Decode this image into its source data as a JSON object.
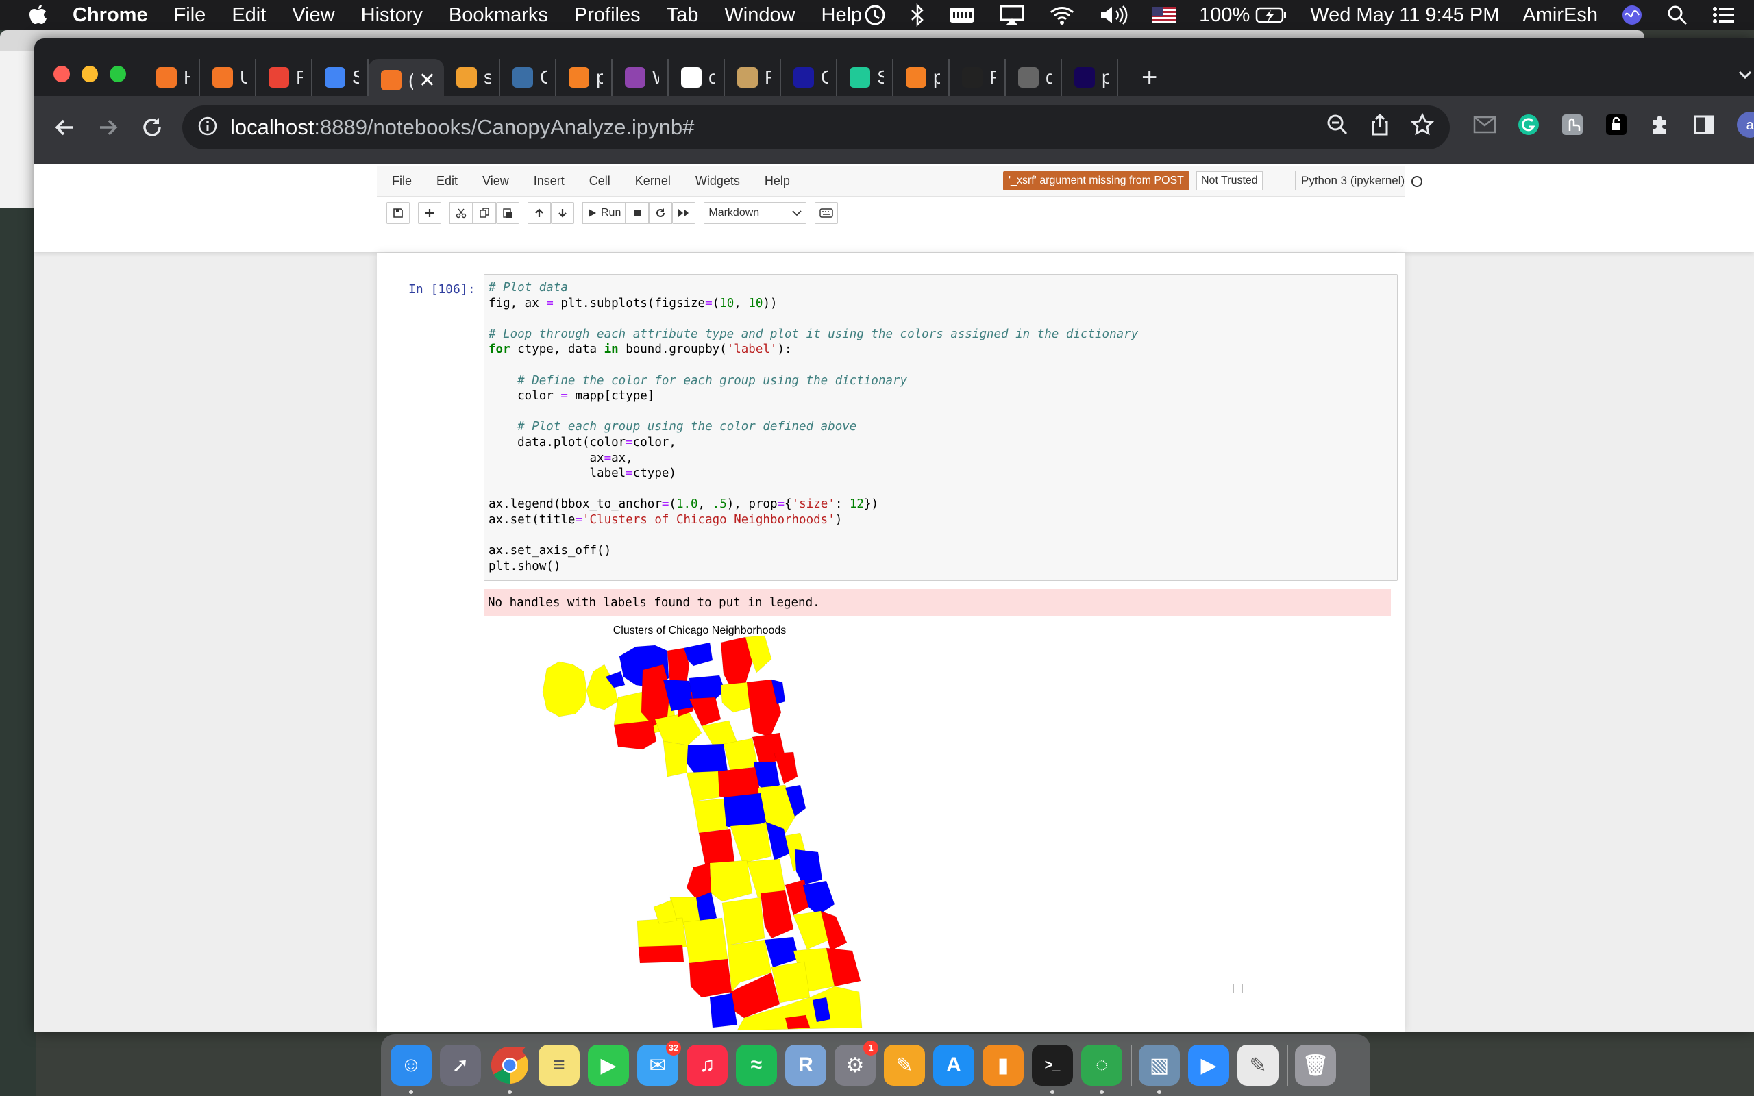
{
  "menubar": {
    "items": [
      "Chrome",
      "File",
      "Edit",
      "View",
      "History",
      "Bookmarks",
      "Profiles",
      "Tab",
      "Window",
      "Help"
    ],
    "battery": "100%",
    "datetime": "Wed May 11  9:45 PM",
    "user": "AmirEsh"
  },
  "tabs": [
    {
      "label": "Hom",
      "color": "#f37626"
    },
    {
      "label": "Unti",
      "color": "#f37626"
    },
    {
      "label": "Fwd",
      "color": "#ea4335"
    },
    {
      "label": "SoR",
      "color": "#4285f4"
    },
    {
      "label": "(",
      "color": "#f37626"
    },
    {
      "label": "skle",
      "color": "#f0a030"
    },
    {
      "label": "Cus",
      "color": "#3a6ea5"
    },
    {
      "label": "pyth",
      "color": "#f48024"
    },
    {
      "label": "War",
      "color": "#8e44ad"
    },
    {
      "label": "chic",
      "color": "#ffffff"
    },
    {
      "label": "Plot",
      "color": "#c8a060"
    },
    {
      "label": "Ope",
      "color": "#1a1aa0"
    },
    {
      "label": "Sha",
      "color": "#20c997"
    },
    {
      "label": "pyth",
      "color": "#f48024"
    },
    {
      "label": "Plot",
      "color": "#222222"
    },
    {
      "label": "data",
      "color": "#666666"
    },
    {
      "label": "pan",
      "color": "#150458"
    }
  ],
  "address": {
    "host": "localhost",
    "rest": ":8889/notebooks/CanopyAnalyze.ipynb#"
  },
  "profile_initial": "a",
  "notebook": {
    "menu": [
      "File",
      "Edit",
      "View",
      "Insert",
      "Cell",
      "Kernel",
      "Widgets",
      "Help"
    ],
    "xsrf_warning": "'_xsrf' argument missing from POST",
    "trust": "Not Trusted",
    "kernel": "Python 3 (ipykernel)",
    "run_label": "Run",
    "cell_type": "Markdown",
    "prompt": "In [106]:",
    "code_lines": [
      [
        [
          "cm",
          "# Plot data"
        ]
      ],
      [
        [
          "",
          "fig, ax "
        ],
        [
          "op",
          "="
        ],
        [
          "",
          " plt.subplots(figsize"
        ],
        [
          "op",
          "="
        ],
        [
          "",
          "("
        ],
        [
          "nu",
          "10"
        ],
        [
          "",
          ", "
        ],
        [
          "nu",
          "10"
        ],
        [
          "",
          "))"
        ]
      ],
      [
        [
          "",
          ""
        ]
      ],
      [
        [
          "cm",
          "# Loop through each attribute type and plot it using the colors assigned in the dictionary"
        ]
      ],
      [
        [
          "kw",
          "for"
        ],
        [
          "",
          " ctype, data "
        ],
        [
          "kw",
          "in"
        ],
        [
          "",
          " bound.groupby("
        ],
        [
          "st",
          "'label'"
        ],
        [
          "",
          "):"
        ]
      ],
      [
        [
          "",
          ""
        ]
      ],
      [
        [
          "",
          "    "
        ],
        [
          "cm",
          "# Define the color for each group using the dictionary"
        ]
      ],
      [
        [
          "",
          "    color "
        ],
        [
          "op",
          "="
        ],
        [
          "",
          " mapp[ctype]"
        ]
      ],
      [
        [
          "",
          ""
        ]
      ],
      [
        [
          "",
          "    "
        ],
        [
          "cm",
          "# Plot each group using the color defined above"
        ]
      ],
      [
        [
          "",
          "    data.plot(color"
        ],
        [
          "op",
          "="
        ],
        [
          "",
          "color,"
        ]
      ],
      [
        [
          "",
          "              ax"
        ],
        [
          "op",
          "="
        ],
        [
          "",
          "ax,"
        ]
      ],
      [
        [
          "",
          "              label"
        ],
        [
          "op",
          "="
        ],
        [
          "",
          "ctype)"
        ]
      ],
      [
        [
          "",
          ""
        ]
      ],
      [
        [
          "",
          "ax.legend(bbox_to_anchor"
        ],
        [
          "op",
          "="
        ],
        [
          "",
          "("
        ],
        [
          "nu",
          "1.0"
        ],
        [
          "",
          ", "
        ],
        [
          "nu",
          ".5"
        ],
        [
          "",
          "), prop"
        ],
        [
          "op",
          "="
        ],
        [
          "",
          "{"
        ],
        [
          "st",
          "'size'"
        ],
        [
          "",
          ": "
        ],
        [
          "nu",
          "12"
        ],
        [
          "",
          "})"
        ]
      ],
      [
        [
          "",
          "ax.set(title"
        ],
        [
          "op",
          "="
        ],
        [
          "st",
          "'Clusters of Chicago Neighborhoods'"
        ],
        [
          "",
          ")"
        ]
      ],
      [
        [
          "",
          ""
        ]
      ],
      [
        [
          "",
          "ax.set_axis_off()"
        ]
      ],
      [
        [
          "",
          "plt.show()"
        ]
      ]
    ],
    "stderr": "No handles with labels found to put in legend.",
    "plot_title": "Clusters of Chicago Neighborhoods"
  },
  "map_colors": {
    "cluster_a": "#ff0000",
    "cluster_b": "#0000ff",
    "cluster_c": "#ffff00"
  },
  "dock": [
    {
      "name": "finder",
      "color": "#2c8cf0",
      "glyph": "☺",
      "running": true
    },
    {
      "name": "launchpad",
      "color": "#6b6b78",
      "glyph": "➚"
    },
    {
      "name": "chrome",
      "color": "#ffffff",
      "glyph": "",
      "running": true
    },
    {
      "name": "notes",
      "color": "#f7e27a",
      "glyph": "≡"
    },
    {
      "name": "facetime",
      "color": "#2fc84f",
      "glyph": "▶"
    },
    {
      "name": "messages",
      "color": "#3ba3f5",
      "glyph": "✉",
      "badge": "32"
    },
    {
      "name": "music",
      "color": "#fa2d48",
      "glyph": "♫"
    },
    {
      "name": "spotify",
      "color": "#1db954",
      "glyph": "≈"
    },
    {
      "name": "r-app",
      "color": "#7aa3d6",
      "glyph": "R"
    },
    {
      "name": "system-preferences",
      "color": "#7d7d86",
      "glyph": "⚙",
      "badge": "1"
    },
    {
      "name": "pages",
      "color": "#f5a623",
      "glyph": "✎"
    },
    {
      "name": "app-store",
      "color": "#1d8ff5",
      "glyph": "A"
    },
    {
      "name": "books",
      "color": "#f28b1e",
      "glyph": "▮"
    },
    {
      "name": "terminal",
      "color": "#1e1e1e",
      "glyph": ">_",
      "running": true
    },
    {
      "name": "spinner-app",
      "color": "#2fa84f",
      "glyph": "◌",
      "running": true
    },
    {
      "name": "preview",
      "color": "#6d8fb0",
      "glyph": "▧",
      "running": true
    },
    {
      "name": "zoom",
      "color": "#2d8cff",
      "glyph": "▶"
    },
    {
      "name": "textedit",
      "color": "#e9e9e9",
      "glyph": "✎"
    },
    {
      "name": "trash",
      "color": "#9a9aa0",
      "glyph": "🗑"
    }
  ]
}
